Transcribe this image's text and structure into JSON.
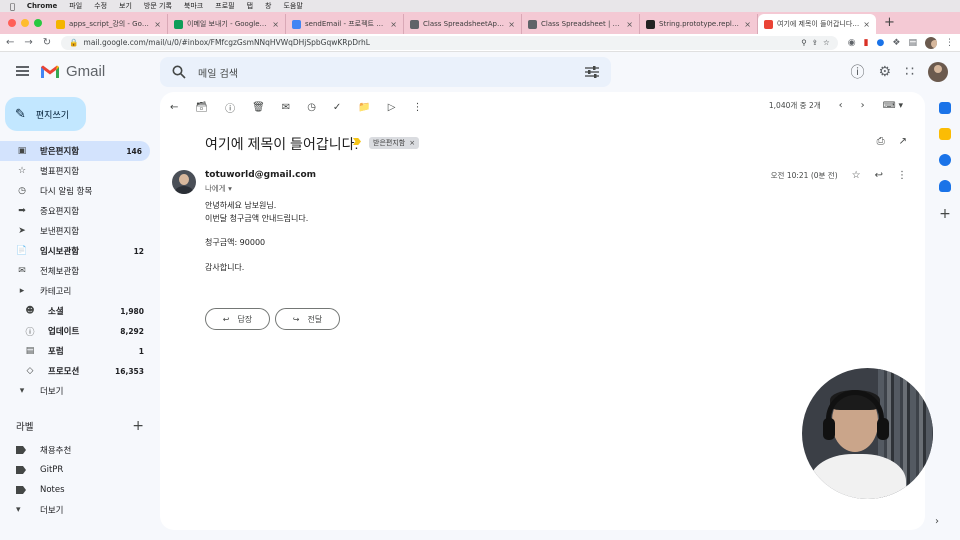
{
  "menubar": {
    "app": "Chrome",
    "items": [
      "파일",
      "수정",
      "보기",
      "방문 기록",
      "북마크",
      "프로필",
      "탭",
      "창",
      "도움말"
    ]
  },
  "tabs": [
    {
      "title": "apps_script_강의 - Google Drive",
      "color": "#f4b400"
    },
    {
      "title": "이메일 보내기 - Google Sheets",
      "color": "#0f9d58"
    },
    {
      "title": "sendEmail - 프로젝트 편집자 - Apps Script",
      "color": "#4285f4"
    },
    {
      "title": "Class SpreadsheetApp | Apps Script",
      "color": "#5f6368"
    },
    {
      "title": "Class Spreadsheet | Apps Script",
      "color": "#5f6368"
    },
    {
      "title": "String.prototype.replace() - JavaScript",
      "color": "#222222"
    },
    {
      "title": "여기에 제목이 들어갑니다. - totuworld@gmail.com",
      "color": "#ea4335",
      "active": true
    }
  ],
  "address": {
    "url": "mail.google.com/mail/u/0/#inbox/FMfcgzGsmNNqHVWqDHjSpbGqwKRpDrhL"
  },
  "header": {
    "logo_text": "Gmail",
    "search_placeholder": "메일 검색"
  },
  "compose_label": "편지쓰기",
  "nav": [
    {
      "label": "받은편지함",
      "count": "146",
      "icon": "inbox-icon",
      "active": true,
      "bold": true
    },
    {
      "label": "별표편지함",
      "count": "",
      "icon": "star-icon"
    },
    {
      "label": "다시 알림 항목",
      "count": "",
      "icon": "clock-icon"
    },
    {
      "label": "중요편지함",
      "count": "",
      "icon": "important-icon"
    },
    {
      "label": "보낸편지함",
      "count": "",
      "icon": "send-icon"
    },
    {
      "label": "임시보관함",
      "count": "12",
      "icon": "draft-icon",
      "bold": true
    },
    {
      "label": "전체보관함",
      "count": "",
      "icon": "all-mail-icon"
    },
    {
      "label": "카테고리",
      "count": "",
      "icon": "category-icon"
    },
    {
      "label": "소셜",
      "count": "1,980",
      "icon": "social-icon",
      "bold": true,
      "sub": true
    },
    {
      "label": "업데이트",
      "count": "8,292",
      "icon": "info-icon",
      "bold": true,
      "sub": true
    },
    {
      "label": "포럼",
      "count": "1",
      "icon": "forum-icon",
      "bold": true,
      "sub": true
    },
    {
      "label": "프로모션",
      "count": "16,353",
      "icon": "tag-icon",
      "bold": true,
      "sub": true
    },
    {
      "label": "더보기",
      "count": "",
      "icon": "chevron-down-icon"
    }
  ],
  "labels": {
    "heading": "라벨",
    "items": [
      "채용추천",
      "GitPR",
      "Notes"
    ],
    "more": "더보기"
  },
  "pager": {
    "text": "1,040개 중 2개"
  },
  "email": {
    "subject": "여기에 제목이 들어갑니다.",
    "label_chip": "받은편지함",
    "sender": "totuworld@gmail.com",
    "to": "나에게",
    "time": "오전 10:21 (0분 전)",
    "body": [
      "안녕하세요 남보원님.",
      "이번달 청구금액 안내드립니다.",
      "",
      "청구금액: 90000",
      "",
      "감사합니다."
    ]
  },
  "actions": {
    "reply": "답장",
    "forward": "전달"
  },
  "colors": {
    "accent_compose": "#c2e7ff",
    "active_nav": "#d3e3fd",
    "tabstrip": "#f4c9d4"
  }
}
